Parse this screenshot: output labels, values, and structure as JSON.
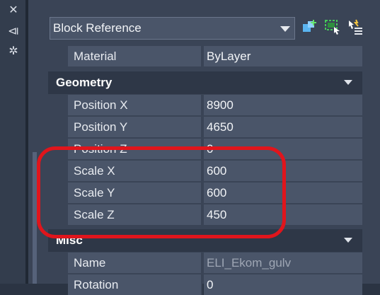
{
  "left_toolbar": {
    "close_glyph": "✕",
    "pin_glyph": "⧏",
    "settings_glyph": "✲"
  },
  "header": {
    "object_type": "Block Reference",
    "buttons": [
      "add-selected-icon",
      "quick-select-icon",
      "select-objects-icon"
    ]
  },
  "rows_top": [
    {
      "label": "Material",
      "value": "ByLayer"
    }
  ],
  "sections": {
    "geometry": {
      "title": "Geometry"
    },
    "misc": {
      "title": "Misc"
    }
  },
  "geometry_rows": [
    {
      "label": "Position X",
      "value": "8900"
    },
    {
      "label": "Position Y",
      "value": "4650"
    },
    {
      "label": "Position Z",
      "value": "0"
    },
    {
      "label": "Scale X",
      "value": "600"
    },
    {
      "label": "Scale Y",
      "value": "600"
    },
    {
      "label": "Scale Z",
      "value": "450"
    }
  ],
  "misc_rows": [
    {
      "label": "Name",
      "value": "ELI_Ekom_gulv"
    },
    {
      "label": "Rotation",
      "value": "0"
    }
  ],
  "colors": {
    "panel": "#3a4456",
    "row": "#4a5569",
    "section": "#2e3747",
    "highlight": "#e0151c"
  }
}
